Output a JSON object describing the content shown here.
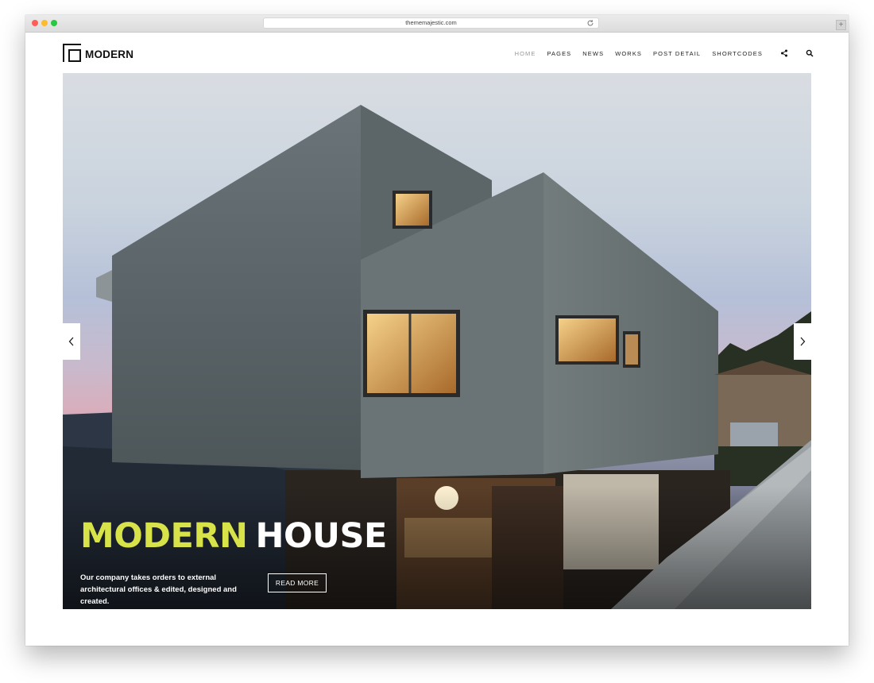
{
  "browser": {
    "url": "thememajestic.com",
    "new_tab_glyph": "+",
    "icons": [
      "reload-icon",
      "new-tab-icon"
    ]
  },
  "site": {
    "logo_text": "MODERN",
    "nav": [
      {
        "label": "HOME",
        "active": true
      },
      {
        "label": "PAGES",
        "active": false
      },
      {
        "label": "NEWS",
        "active": false
      },
      {
        "label": "WORKS",
        "active": false
      },
      {
        "label": "POST DETAIL",
        "active": false
      },
      {
        "label": "SHORTCODES",
        "active": false
      }
    ],
    "nav_icons": [
      "share-icon",
      "search-icon"
    ]
  },
  "hero": {
    "title_word1": "MODERN",
    "title_word2": "HOUSE",
    "description": "Our company takes orders to external architectural offices & edited, designed and created.",
    "button_label": "READ MORE",
    "slider_icons": [
      "chevron-left-icon",
      "chevron-right-icon"
    ]
  },
  "colors": {
    "accent": "#d8e34a",
    "text_dark": "#111111",
    "nav_active": "#9a9a9a"
  }
}
